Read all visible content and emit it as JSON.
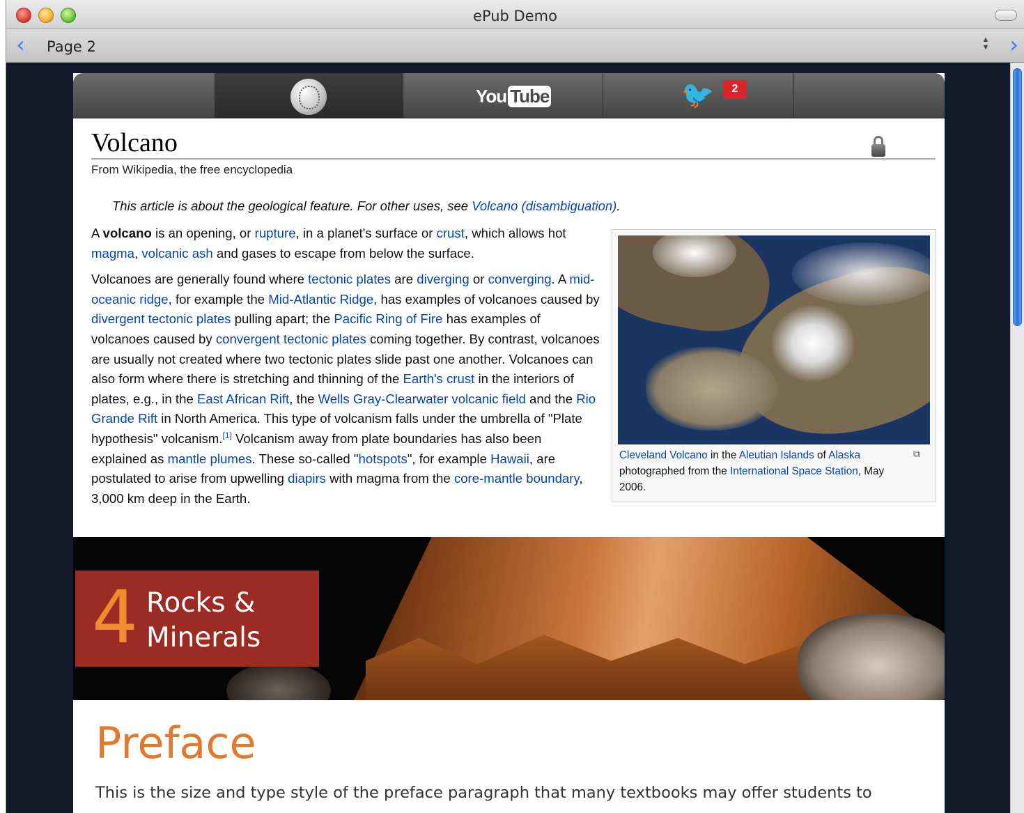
{
  "window": {
    "title": "ePub Demo",
    "page_label": "Page 2",
    "prev_arrow": "‹",
    "next_arrow": "›",
    "stepper_up": "▲",
    "stepper_down": "▼"
  },
  "widgets": {
    "youtube_you": "You",
    "youtube_tube": "Tube",
    "twitter_bird": "🐦",
    "twitter_badge": "2"
  },
  "article": {
    "title": "Volcano",
    "subtitle": "From Wikipedia, the free encyclopedia",
    "hatnote_text": "This article is about the geological feature. For other uses, see ",
    "hatnote_link": "Volcano (disambiguation)",
    "hatnote_end": ".",
    "p1": [
      {
        "t": "A ",
        "l": false
      },
      {
        "t": "volcano",
        "b": true
      },
      {
        "t": " is an opening, or ",
        "l": false
      },
      {
        "t": "rupture",
        "l": true
      },
      {
        "t": ", in a planet's surface or ",
        "l": false
      },
      {
        "t": "crust",
        "l": true
      },
      {
        "t": ", which allows hot ",
        "l": false
      },
      {
        "t": "magma",
        "l": true
      },
      {
        "t": ", ",
        "l": false
      },
      {
        "t": "volcanic ash",
        "l": true
      },
      {
        "t": " and gases to escape from below the surface.",
        "l": false
      }
    ],
    "p2": [
      {
        "t": "Volcanoes are generally found where ",
        "l": false
      },
      {
        "t": "tectonic plates",
        "l": true
      },
      {
        "t": " are ",
        "l": false
      },
      {
        "t": "diverging",
        "l": true
      },
      {
        "t": " or ",
        "l": false
      },
      {
        "t": "converging",
        "l": true
      },
      {
        "t": ". A ",
        "l": false
      },
      {
        "t": "mid-oceanic ridge",
        "l": true
      },
      {
        "t": ", for example the ",
        "l": false
      },
      {
        "t": "Mid-Atlantic Ridge",
        "l": true
      },
      {
        "t": ", has examples of volcanoes caused by ",
        "l": false
      },
      {
        "t": "divergent tectonic plates",
        "l": true
      },
      {
        "t": " pulling apart; the ",
        "l": false
      },
      {
        "t": "Pacific Ring of Fire",
        "l": true
      },
      {
        "t": " has examples of volcanoes caused by ",
        "l": false
      },
      {
        "t": "convergent tectonic plates",
        "l": true
      },
      {
        "t": " coming together. By contrast, volcanoes are usually not created where two tectonic plates slide past one another. Volcanoes can also form where there is stretching and thinning of the ",
        "l": false
      },
      {
        "t": "Earth's crust",
        "l": true
      },
      {
        "t": " in the interiors of plates, e.g., in the ",
        "l": false
      },
      {
        "t": "East African Rift",
        "l": true
      },
      {
        "t": ", the ",
        "l": false
      },
      {
        "t": "Wells Gray-Clearwater volcanic field",
        "l": true
      },
      {
        "t": " and the ",
        "l": false
      },
      {
        "t": "Rio Grande Rift",
        "l": true
      },
      {
        "t": " in North America. This type of volcanism falls under the umbrella of \"Plate hypothesis\" volcanism.",
        "l": false
      },
      {
        "t": "[1]",
        "l": true,
        "sup": true
      },
      {
        "t": " Volcanism away from plate boundaries has also been explained as ",
        "l": false
      },
      {
        "t": "mantle plumes",
        "l": true
      },
      {
        "t": ". These so-called \"",
        "l": false
      },
      {
        "t": "hotspots",
        "l": true
      },
      {
        "t": "\", for example ",
        "l": false
      },
      {
        "t": "Hawaii",
        "l": true
      },
      {
        "t": ", are postulated to arise from upwelling ",
        "l": false
      },
      {
        "t": "diapirs",
        "l": true
      },
      {
        "t": " with magma from the ",
        "l": false
      },
      {
        "t": "core-mantle boundary",
        "l": true
      },
      {
        "t": ", 3,000 km deep in the Earth.",
        "l": false
      }
    ],
    "caption": [
      {
        "t": "Cleveland Volcano",
        "l": true
      },
      {
        "t": " in the ",
        "l": false
      },
      {
        "t": "Aleutian Islands",
        "l": true
      },
      {
        "t": " of ",
        "l": false
      },
      {
        "t": "Alaska",
        "l": true
      },
      {
        "t": " photographed from the ",
        "l": false
      },
      {
        "t": "International Space Station",
        "l": true
      },
      {
        "t": ", May 2006.",
        "l": false
      }
    ],
    "enlarge_glyph": "⧉"
  },
  "chapter": {
    "number": "4",
    "title": "Rocks & Minerals"
  },
  "preface": {
    "heading": "Preface",
    "text": "This is the size and type style of the preface paragraph that many textbooks may offer students to"
  },
  "colors": {
    "link": "#0645ad",
    "chapter_box": "#9b2b23",
    "chapter_number": "#f28a2e",
    "preface_heading": "#e07a2e",
    "badge": "#d9262c"
  }
}
